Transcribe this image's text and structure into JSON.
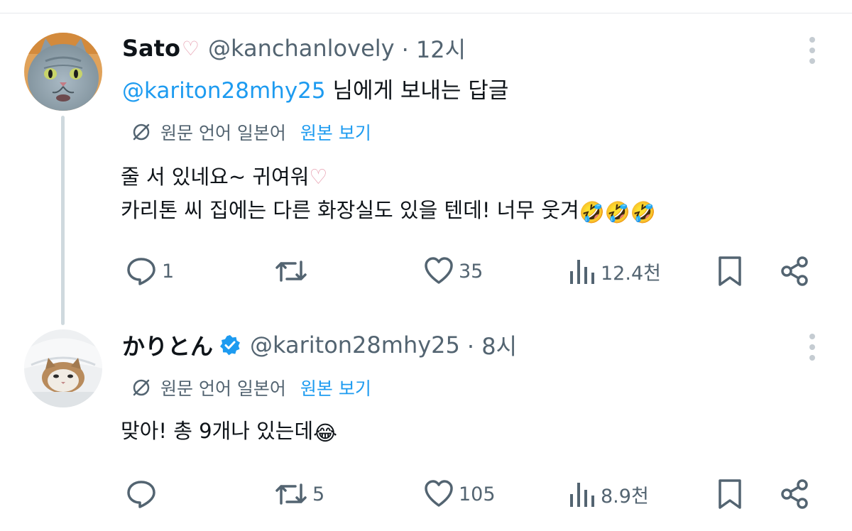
{
  "posts": [
    {
      "display_name": "Sato",
      "name_heart": "♡",
      "handle": "@kanchanlovely",
      "time": "· 12시",
      "reply_mention": "@kariton28mhy25",
      "reply_suffix": " 님에게 보내는 답글",
      "translate": {
        "lang_label": "원문 언어 일본어",
        "show_original": "원본 보기"
      },
      "body_line1": "줄 서 있네요~ 귀여워",
      "body_line1_heart": "♡",
      "body_line2": "카리톤 씨 집에는 다른 화장실도 있을 텐데! 너무 웃겨",
      "body_line2_emoji": "🤣🤣🤣",
      "avatar_icon": "cat-avatar-blue-gray",
      "stats": {
        "replies": "1",
        "reposts": "",
        "likes": "35",
        "views": "12.4천"
      }
    },
    {
      "display_name": "かりとん",
      "handle": "@kariton28mhy25",
      "time": "· 8시",
      "verified_icon": "verified-badge-icon",
      "translate": {
        "lang_label": "원문 언어 일본어",
        "show_original": "원본 보기"
      },
      "body_line1": "맞아! 총 9개나 있는데",
      "body_line1_emoji": "😂",
      "avatar_icon": "cat-avatar-white",
      "stats": {
        "replies": "",
        "reposts": "5",
        "likes": "105",
        "views": "8.9천"
      }
    }
  ],
  "colors": {
    "accent": "#1d9bf0",
    "muted": "#536471",
    "text": "#0f1419",
    "thread_line": "#cfd9de",
    "heart": "#e8a3b3"
  }
}
